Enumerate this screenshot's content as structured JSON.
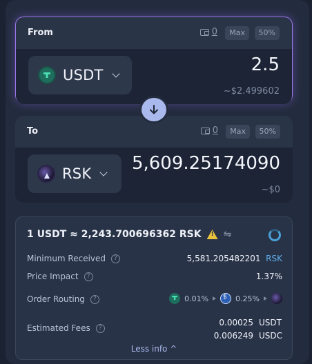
{
  "from": {
    "title": "From",
    "balance": "0",
    "max_label": "Max",
    "pct_label": "50%",
    "token": "USDT",
    "amount": "2.5",
    "usd_value": "~$2.499602"
  },
  "to": {
    "title": "To",
    "balance": "0",
    "max_label": "Max",
    "pct_label": "50%",
    "token": "RSK",
    "amount": "5,609.25174090",
    "usd_value": "~$0"
  },
  "info": {
    "rate": "1 USDT ≈ 2,243.700696362 RSK",
    "switch_glyph": "⇋",
    "min_received_label": "Minimum Received",
    "min_received_value": "5,581.205482201",
    "min_received_unit": "RSK",
    "price_impact_label": "Price Impact",
    "price_impact_value": "1.37%",
    "order_routing_label": "Order Routing",
    "routing_fee_1": "0.01%",
    "routing_fee_2": "0.25%",
    "estimated_fees_label": "Estimated Fees",
    "fee_1_value": "0.00025",
    "fee_1_unit": "USDT",
    "fee_2_value": "0.006249",
    "fee_2_unit": "USDC",
    "less_info_label": "Less info ^",
    "help_glyph": "?"
  },
  "colors": {
    "accent": "#5eb0ef",
    "warning": "#f0c43c",
    "focus_border": "#9a78e8",
    "swap_button": "#a9b9ee"
  },
  "icons": [
    "wallet-icon",
    "usdt-token-icon",
    "rsk-token-icon",
    "chevron-down-icon",
    "arrow-down-icon",
    "warning-icon",
    "swap-direction-icon",
    "spinner-icon",
    "help-icon",
    "usdc-token-icon"
  ]
}
